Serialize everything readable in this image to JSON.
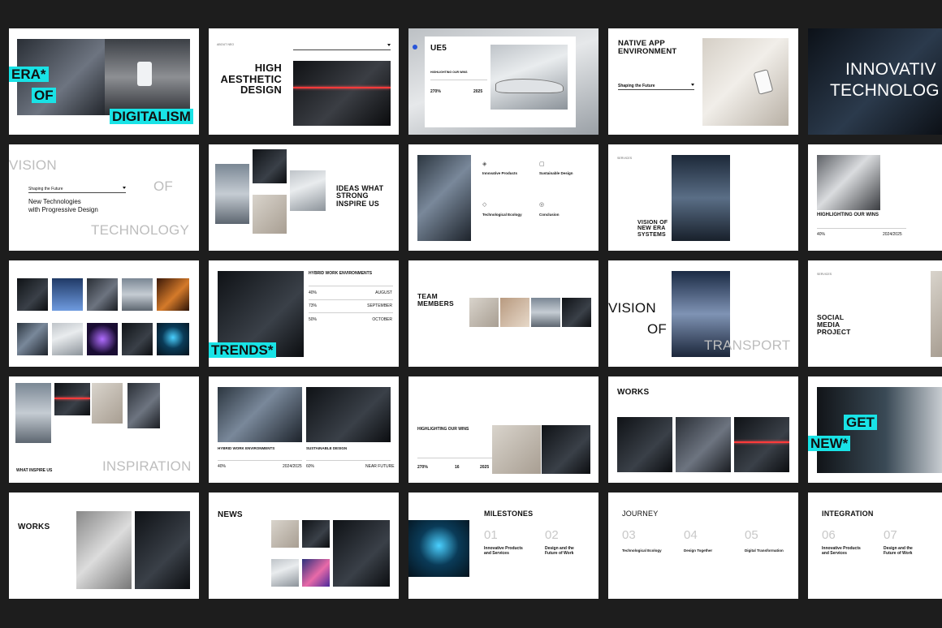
{
  "slides": {
    "s1": {
      "line1": "ERA*",
      "line2": "OF",
      "line3": "DIGITALISM"
    },
    "s2": {
      "label": "ABOUT NEO",
      "title": "HIGH\nAESTHETIC\nDESIGN"
    },
    "s3": {
      "title": "UE5",
      "subtitle": "HIGHLIGHTING OUR WINS",
      "stat1": "270%",
      "stat2": "2025"
    },
    "s4": {
      "title": "NATIVE APP\nENVIRONMENT",
      "subtitle": "Shaping the Future"
    },
    "s5": {
      "line1": "INNOVATIV",
      "line2": "TECHNOLOG"
    },
    "s6": {
      "w1": "VISION",
      "w2": "OF",
      "w3": "TECHNOLOGY",
      "select": "Shaping the Future",
      "body": "New Technologies\nwith Progressive Design"
    },
    "s7": {
      "title": "IDEAS WHAT\nSTRONG\nINSPIRE US"
    },
    "s8": {
      "h1": "Innovative Products",
      "h2": "Sustainable Design",
      "h3": "Technological Ecology",
      "h4": "Conclusion"
    },
    "s9": {
      "label": "SERVICES",
      "title": "VISION OF\nNEW ERA\nSYSTEMS"
    },
    "s10": {
      "title": "HIGHLIGHTING OUR WINS",
      "stat1": "40%",
      "stat2": "2024/2025"
    },
    "s11": {},
    "s12": {
      "title": "HYBRID WORK ENVIRONMENTS",
      "r1a": "40%",
      "r1b": "AUGUST",
      "r2a": "73%",
      "r2b": "SEPTEMBER",
      "r3a": "50%",
      "r3b": "OCTOBER",
      "tag": "TRENDS*"
    },
    "s13": {
      "title": "TEAM\nMEMBERS"
    },
    "s14": {
      "w1": "VISION",
      "w2": "OF",
      "w3": "TRANSPORT"
    },
    "s15": {
      "label": "SERVICES",
      "title": "SOCIAL\nMEDIA\nPROJECT"
    },
    "s16": {
      "caption": "WHAT INSPIRE US",
      "word": "INSPIRATION"
    },
    "s17": {
      "h1": "HYBRID WORK ENVIRONMENTS",
      "h2": "SUSTAINABLE DESIGN",
      "v1": "40%",
      "v2": "2024/2025",
      "v3": "60%",
      "v4": "NEAR FUTURE"
    },
    "s18": {
      "title": "HIGHLIGHTING OUR WINS",
      "stat1": "270%",
      "stat2": "16",
      "stat3": "2025"
    },
    "s19": {
      "title": "WORKS"
    },
    "s20": {
      "line1": "GET",
      "line2": "NEW*"
    },
    "s21": {
      "title": "WORKS"
    },
    "s22": {
      "title": "NEWS"
    },
    "s23": {
      "title": "MILESTONES",
      "n1": "01",
      "n2": "02",
      "h1": "Innovative Products\nand Services",
      "h2": "Design and the\nFuture of Work"
    },
    "s24": {
      "title": "JOURNEY",
      "n1": "03",
      "n2": "04",
      "n3": "05",
      "h1": "Technological Ecology",
      "h2": "Design Together",
      "h3": "Digital Transformation"
    },
    "s25": {
      "title": "INTEGRATION",
      "n1": "06",
      "n2": "07",
      "h1": "Innovative Products\nand Services",
      "h2": "Design and the\nFuture of Work"
    }
  },
  "colors": {
    "background": "#1d1d1d",
    "accent": "#19e3e6",
    "slide": "#ffffff",
    "laser": "#ff3a3a"
  }
}
